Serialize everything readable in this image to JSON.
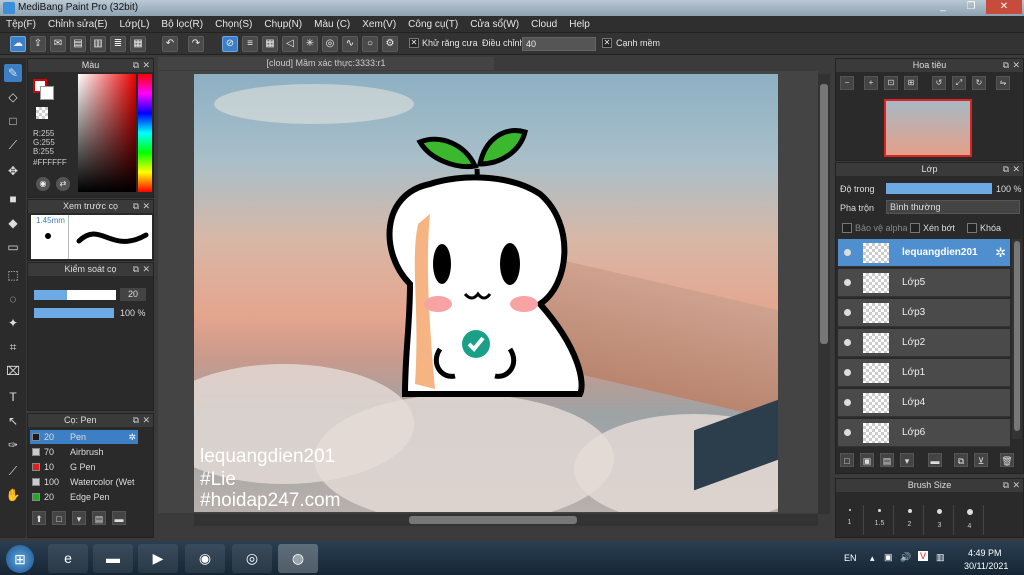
{
  "window": {
    "title": "MediBang Paint Pro (32bit)"
  },
  "menu": [
    "Tệp(F)",
    "Chỉnh sửa(E)",
    "Lớp(L)",
    "Bộ lọc(R)",
    "Chọn(S)",
    "Chụp(N)",
    "Màu (C)",
    "Xem(V)",
    "Công cụ(T)",
    "Cửa sổ(W)",
    "Cloud",
    "Help"
  ],
  "toolbar": {
    "anti_alias_label": "Khử răng cưa",
    "adjust_label": "Điều chỉnh",
    "adjust_value": "40",
    "edge_label": "Cạnh mềm"
  },
  "color_panel": {
    "title": "Màu",
    "r": "R:255",
    "g": "G:255",
    "b": "B:255",
    "hex": "#FFFFFF"
  },
  "preview_panel": {
    "title": "Xem trước cọ",
    "size": "1.45mm"
  },
  "control_panel": {
    "title": "Kiểm soát cọ",
    "size_value": "20",
    "size_fraction": 0.4,
    "opacity_value": "100 %",
    "opacity_fraction": 1.0
  },
  "brush_panel": {
    "title": "Cọ: Pen",
    "brushes": [
      {
        "size": "20",
        "name": "Pen",
        "color": "#1a1a1a",
        "selected": true
      },
      {
        "size": "70",
        "name": "Airbrush",
        "color": "#cccccc",
        "selected": false
      },
      {
        "size": "10",
        "name": "G Pen",
        "color": "#e02020",
        "selected": false
      },
      {
        "size": "100",
        "name": "Watercolor (Wet",
        "color": "#cccccc",
        "selected": false
      },
      {
        "size": "20",
        "name": "Edge Pen",
        "color": "#22aa22",
        "selected": false
      }
    ]
  },
  "document": {
    "tab": "[cloud] Mầm xác thực:3333:r1"
  },
  "canvas_text": [
    "lequangdien201",
    "#Lie",
    "#hoidap247.com"
  ],
  "navigator": {
    "title": "Hoa tiêu"
  },
  "layer_panel": {
    "title": "Lớp",
    "opacity_label": "Độ trong",
    "opacity_value": "100 %",
    "opacity_fraction": 1.0,
    "blend_label": "Pha trộn",
    "blend_value": "Bình thường",
    "protect_alpha": "Bảo vệ alpha",
    "clip": "Xén bớt",
    "lock": "Khóa",
    "layers": [
      {
        "name": "lequangdien201",
        "selected": true
      },
      {
        "name": "Lớp5",
        "selected": false
      },
      {
        "name": "Lớp3",
        "selected": false
      },
      {
        "name": "Lớp2",
        "selected": false
      },
      {
        "name": "Lớp1",
        "selected": false
      },
      {
        "name": "Lớp4",
        "selected": false
      },
      {
        "name": "Lớp6",
        "selected": false
      }
    ]
  },
  "brush_size_panel": {
    "title": "Brush Size",
    "sizes": [
      "1",
      "1.5",
      "2",
      "3",
      "4"
    ]
  },
  "taskbar": {
    "lang": "EN",
    "time": "4:49 PM",
    "date": "30/11/2021"
  },
  "colors": {
    "accent": "#3d7fc4",
    "leaf": "#3cb82f",
    "badge": "#1aa088"
  },
  "icons": [
    "pen-icon",
    "eraser-icon",
    "move-icon",
    "fill-icon",
    "text-icon",
    "hand-icon",
    "zoom-in-icon",
    "gear-icon"
  ]
}
